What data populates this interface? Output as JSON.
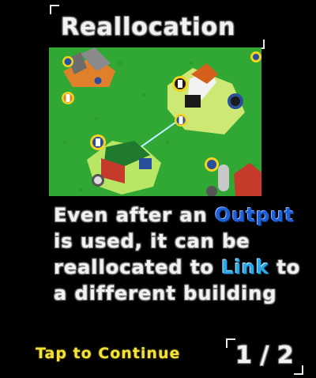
{
  "title": "Reallocation",
  "description": {
    "part1": "Even after an ",
    "kw1": "Output",
    "part2": " is used, it can be reallocated to ",
    "kw2": "Link",
    "part3": " to a different building"
  },
  "continue_label": "Tap to Continue",
  "pager": "1 / 2",
  "colors": {
    "grass": "#31a834",
    "output_keyword": "#1e5fd6",
    "link_keyword": "#2aa8e8",
    "continue_text": "#f3e23a"
  },
  "icons": [
    "rocket-building-icon",
    "house-building-icon",
    "farm-building-icon",
    "silo-building-icon",
    "output-slot-icon",
    "link-beam-icon"
  ]
}
